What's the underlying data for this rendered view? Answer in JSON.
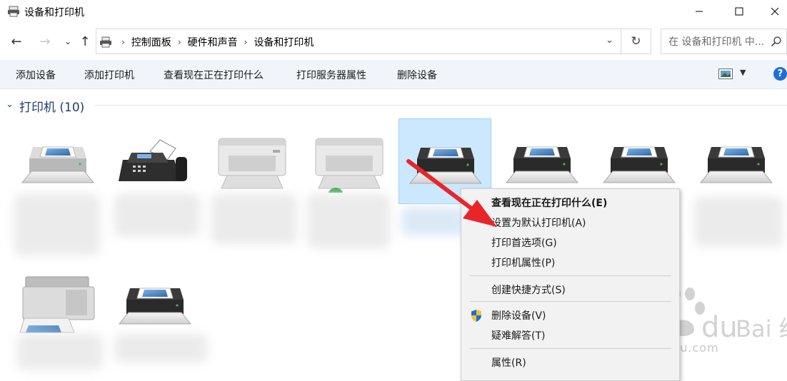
{
  "window": {
    "title": "设备和打印机",
    "icon": "printer-folder-icon"
  },
  "navigation": {
    "breadcrumbs": [
      "控制面板",
      "硬件和声音",
      "设备和打印机"
    ],
    "search_placeholder": "在 设备和打印机 中..."
  },
  "toolbar": {
    "add_device": "添加设备",
    "add_printer": "添加打印机",
    "see_printing": "查看现在正在打印什么",
    "print_server_props": "打印服务器属性",
    "remove_device": "删除设备",
    "help": "?"
  },
  "group": {
    "title": "打印机 (10)"
  },
  "devices": [
    {
      "icon": "printer-icon"
    },
    {
      "icon": "fax-icon"
    },
    {
      "icon": "laser-printer-icon"
    },
    {
      "icon": "laser-printer-default-icon"
    },
    {
      "icon": "printer-icon",
      "selected": true
    },
    {
      "icon": "printer-icon"
    },
    {
      "icon": "printer-icon"
    },
    {
      "icon": "printer-icon"
    },
    {
      "icon": "multifunction-printer-icon"
    },
    {
      "icon": "printer-icon"
    }
  ],
  "context_menu": {
    "items": [
      {
        "label": "查看现在正在打印什么(E)",
        "bold": true
      },
      {
        "label": "设置为默认打印机(A)"
      },
      {
        "label": "打印首选项(G)"
      },
      {
        "label": "打印机属性(P)"
      },
      {
        "label": "创建快捷方式(S)"
      },
      {
        "label": "删除设备(V)",
        "icon": "shield-icon"
      },
      {
        "label": "疑难解答(T)"
      },
      {
        "label": "属性(R)"
      }
    ]
  },
  "watermark": {
    "brand": "Bai 经验",
    "url": "jingyan.baidu.com"
  },
  "colors": {
    "selection": "#cce8ff",
    "command_bar": "#f1f5fa",
    "arrow": "#e8262a",
    "help": "#1e6fd6"
  }
}
